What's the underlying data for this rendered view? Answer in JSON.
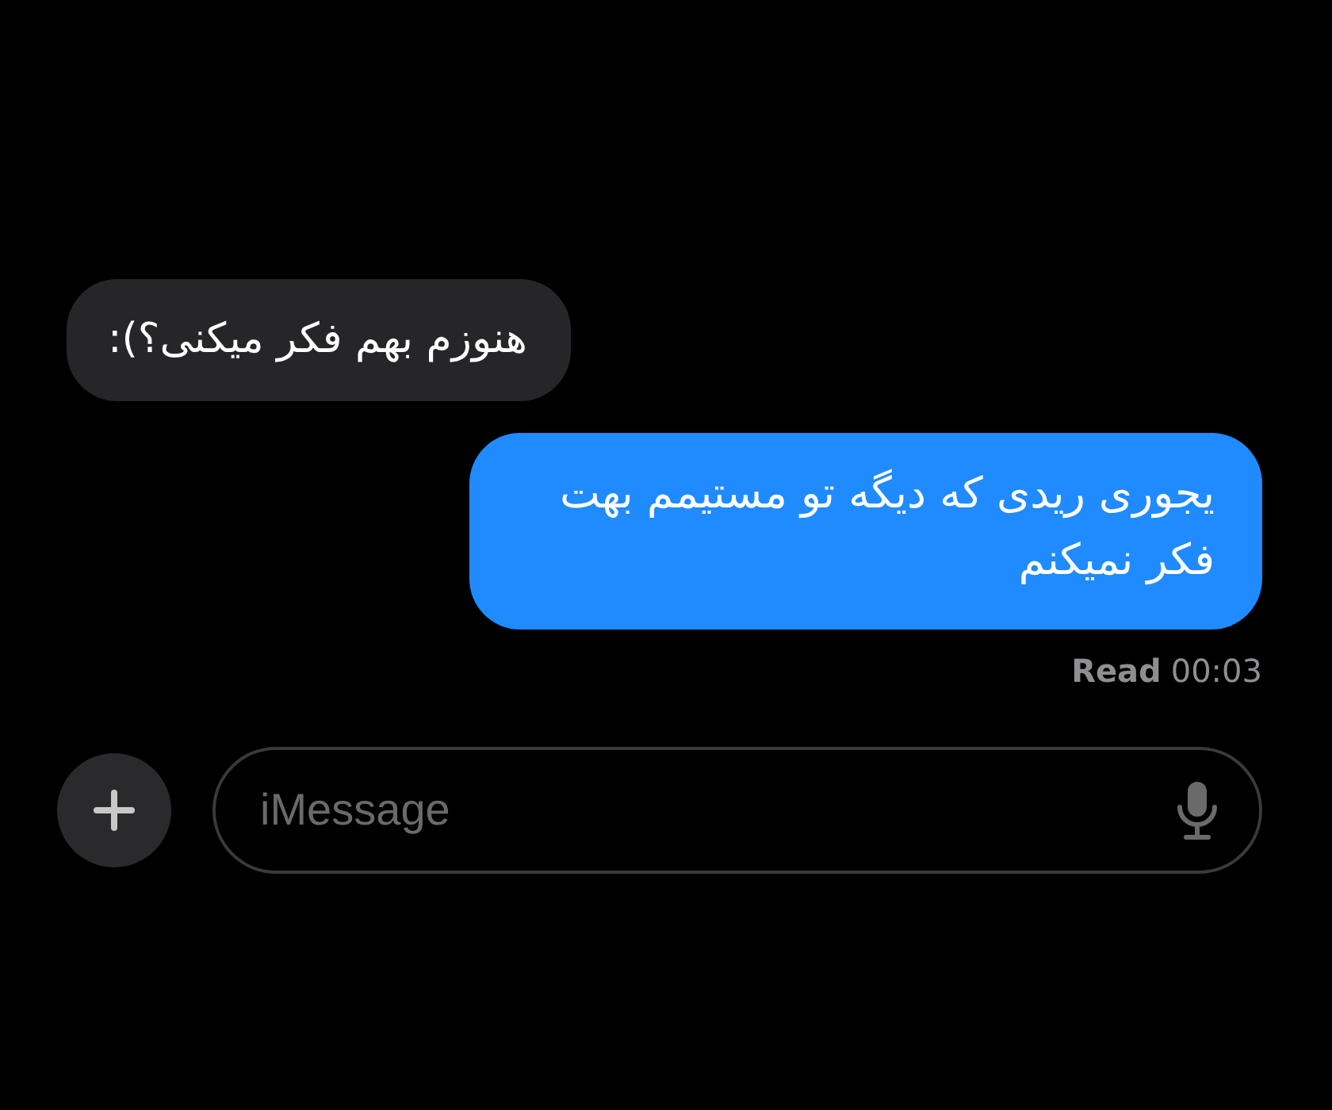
{
  "messages": [
    {
      "kind": "received",
      "text": "هنوزم بهم فکر میکنی؟):"
    },
    {
      "kind": "sent",
      "text": "یجوری ریدی که دیگه تو مستیمم بهت فکر نمیکنم"
    }
  ],
  "receipt": {
    "label": "Read",
    "time": "00:03"
  },
  "composer": {
    "placeholder": "iMessage"
  }
}
